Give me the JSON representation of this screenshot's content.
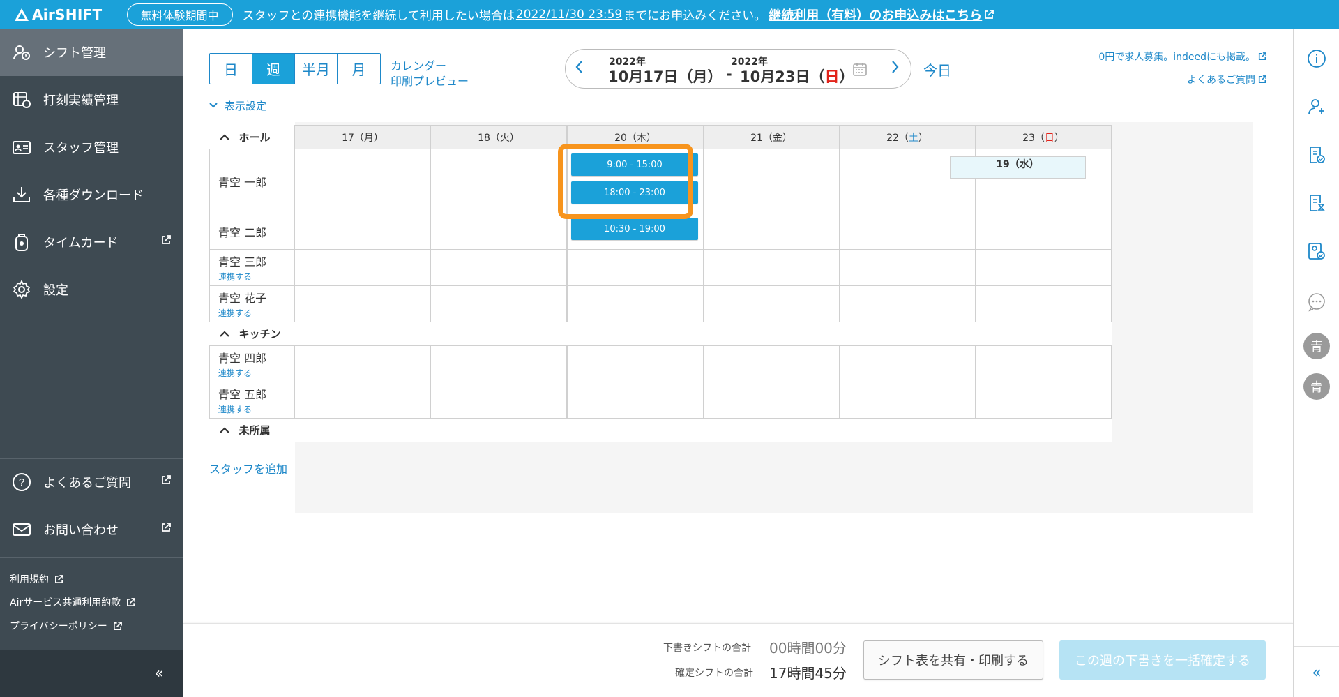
{
  "banner": {
    "logo": "AirSHIFT",
    "trial_badge": "無料体験期間中",
    "message_pre": "スタッフとの連携機能を継続して利用したい場合は",
    "deadline": "2022/11/30 23:59",
    "message_post": "までにお申込みください。",
    "cta": "継続利用（有料）のお申込みはこちら"
  },
  "sidebar": {
    "items": [
      {
        "label": "シフト管理",
        "icon": "shift-icon"
      },
      {
        "label": "打刻実績管理",
        "icon": "timecard-record-icon"
      },
      {
        "label": "スタッフ管理",
        "icon": "staff-card-icon"
      },
      {
        "label": "各種ダウンロード",
        "icon": "download-icon"
      },
      {
        "label": "タイムカード",
        "icon": "timecard-icon"
      },
      {
        "label": "設定",
        "icon": "gear-icon"
      }
    ],
    "help": "よくあるご質問",
    "contact": "お問い合わせ",
    "links": [
      "利用規約",
      "Airサービス共通利用約款",
      "プライバシーポリシー"
    ],
    "collapse": "«"
  },
  "toolbar": {
    "views": [
      "日",
      "週",
      "半月",
      "月"
    ],
    "active_view": "週",
    "calendar_link": "カレンダー",
    "print_link": "印刷プレビュー",
    "range_start_year": "2022年",
    "range_start": "10月17日（月）",
    "range_sep": "-",
    "range_end_year": "2022年",
    "range_end_prefix": "10月23日（",
    "range_end_day": "日",
    "range_end_suffix": "）",
    "today": "今日",
    "recruit_link": "0円で求人募集。indeedにも掲載。",
    "faq_link": "よくあるご質問",
    "display_settings": "表示設定"
  },
  "schedule": {
    "days": [
      {
        "num": "17",
        "dow": "月",
        "cls": ""
      },
      {
        "num": "18",
        "dow": "火",
        "cls": ""
      },
      {
        "num": "19",
        "dow": "水",
        "cls": ""
      },
      {
        "num": "20",
        "dow": "木",
        "cls": ""
      },
      {
        "num": "21",
        "dow": "金",
        "cls": ""
      },
      {
        "num": "22",
        "dow": "土",
        "cls": "sat"
      },
      {
        "num": "23",
        "dow": "日",
        "cls": "sunc"
      }
    ],
    "groups": [
      "ホール",
      "キッチン",
      "未所属"
    ],
    "link_label": "連携する",
    "staff": [
      "青空 一郎",
      "青空 二郎",
      "青空 三郎",
      "青空 花子",
      "青空 四郎",
      "青空 五郎"
    ],
    "shifts": [
      "9:00 - 15:00",
      "18:00 - 23:00",
      "10:30 - 19:00"
    ],
    "add_staff": "スタッフを追加"
  },
  "footer": {
    "draft_label": "下書きシフトの合計",
    "draft_value": "00時間00分",
    "confirmed_label": "確定シフトの合計",
    "confirmed_value": "17時間45分",
    "share_button": "シフト表を共有・印刷する",
    "confirm_button": "この週の下書きを一括確定する"
  },
  "rail": {
    "avatar1": "青",
    "avatar2": "青",
    "collapse": "«"
  },
  "colors": {
    "accent": "#1ba1d9",
    "highlight": "#f7941d",
    "sidebar": "#3e4a52"
  }
}
